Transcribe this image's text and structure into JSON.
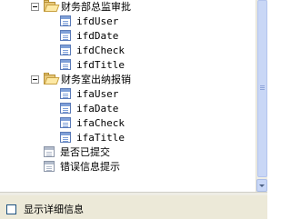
{
  "tree": {
    "groups": [
      {
        "label": "财务部总监审批",
        "children": [
          "ifdUser",
          "ifdDate",
          "ifdCheck",
          "ifdTitle"
        ]
      },
      {
        "label": "财务室出纳报销",
        "children": [
          "ifaUser",
          "ifaDate",
          "ifaCheck",
          "ifaTitle"
        ]
      }
    ],
    "items": [
      "是否已提交",
      "错误信息提示"
    ]
  },
  "options": {
    "show_details_label": "显示详细信息",
    "show_details_checked": false
  }
}
